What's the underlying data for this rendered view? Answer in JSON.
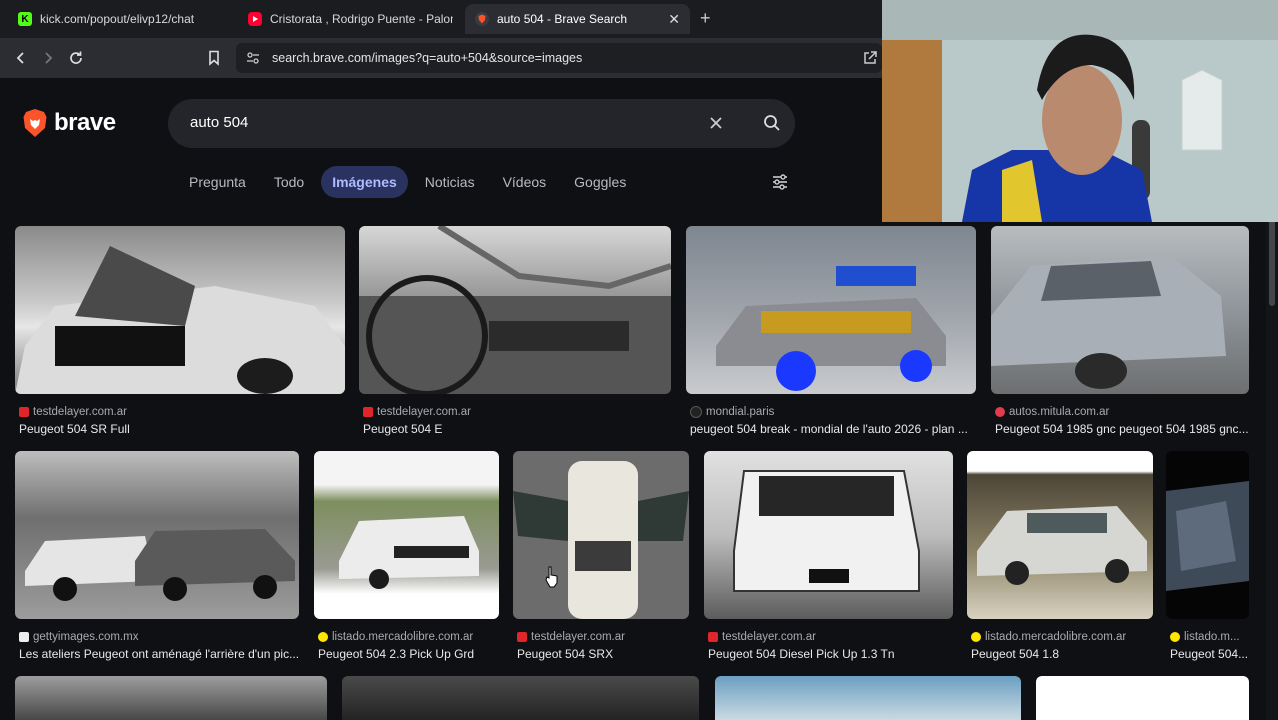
{
  "browser": {
    "tabs": [
      {
        "title": "kick.com/popout/elivp12/chat",
        "favicon": "kick-icon",
        "color": "#53fc18"
      },
      {
        "title": "Cristorata , Rodrigo Puente - Palomit",
        "favicon": "youtube-icon",
        "color": "#ff0033"
      },
      {
        "title": "auto 504 - Brave Search",
        "favicon": "brave-icon",
        "color": "#fb542b"
      }
    ],
    "url": "search.brave.com/images?q=auto+504&source=images"
  },
  "search": {
    "logo_text": "brave",
    "query": "auto 504",
    "tabs": [
      "Pregunta",
      "Todo",
      "Imágenes",
      "Noticias",
      "Vídeos",
      "Goggles"
    ],
    "active_tab": "Imágenes"
  },
  "results": [
    {
      "source": "testdelayer.com.ar",
      "title": "Peugeot 504 SR Full",
      "fav_color": "#e0262a"
    },
    {
      "source": "testdelayer.com.ar",
      "title": "Peugeot 504 E",
      "fav_color": "#e0262a"
    },
    {
      "source": "mondial.paris",
      "title": "peugeot 504 break - mondial de l'auto 2026 - plan ...",
      "fav_color": "#222222"
    },
    {
      "source": "autos.mitula.com.ar",
      "title": "Peugeot 504 1985 gnc peugeot 504 1985 gnc...",
      "fav_color": "#e23b4e"
    },
    {
      "source": "gettyimages.com.mx",
      "title": "Les ateliers Peugeot ont aménagé l'arrière d'un pic...",
      "fav_color": "#eeeeee"
    },
    {
      "source": "listado.mercadolibre.com.ar",
      "title": "Peugeot 504 2.3 Pick Up Grd",
      "fav_color": "#ffe600"
    },
    {
      "source": "testdelayer.com.ar",
      "title": "Peugeot 504 SRX",
      "fav_color": "#e0262a"
    },
    {
      "source": "testdelayer.com.ar",
      "title": "Peugeot 504 Diesel Pick Up 1.3 Tn",
      "fav_color": "#e0262a"
    },
    {
      "source": "listado.mercadolibre.com.ar",
      "title": "Peugeot 504 1.8",
      "fav_color": "#ffe600"
    },
    {
      "source": "listado.m...",
      "title": "Peugeot 504...",
      "fav_color": "#ffe600"
    }
  ],
  "theme": {
    "accent": "#aebcff",
    "active_tab_bg": "#2a3260",
    "page_bg": "#0f1014"
  }
}
